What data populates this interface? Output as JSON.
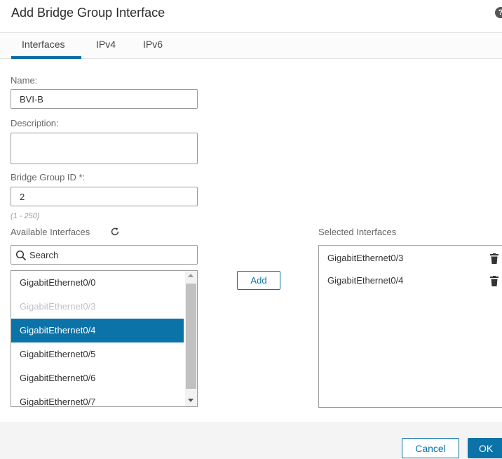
{
  "dialog": {
    "title": "Add Bridge Group Interface",
    "help_icon": "?"
  },
  "tabs": [
    {
      "label": "Interfaces",
      "active": true
    },
    {
      "label": "IPv4",
      "active": false
    },
    {
      "label": "IPv6",
      "active": false
    }
  ],
  "form": {
    "name_label": "Name:",
    "name_value": "BVI-B",
    "description_label": "Description:",
    "description_value": "",
    "bridge_group_id_label": "Bridge Group ID *:",
    "bridge_group_id_value": "2",
    "bridge_group_id_hint": "(1 - 250)"
  },
  "available": {
    "label": "Available Interfaces",
    "refresh_icon": "refresh-icon",
    "search_placeholder": "Search",
    "items": [
      {
        "label": "GigabitEthernet0/0",
        "state": "normal"
      },
      {
        "label": "GigabitEthernet0/3",
        "state": "disabled"
      },
      {
        "label": "GigabitEthernet0/4",
        "state": "selected"
      },
      {
        "label": "GigabitEthernet0/5",
        "state": "normal"
      },
      {
        "label": "GigabitEthernet0/6",
        "state": "normal"
      },
      {
        "label": "GigabitEthernet0/7",
        "state": "normal"
      }
    ]
  },
  "add_button": "Add",
  "selected": {
    "label": "Selected Interfaces",
    "items": [
      {
        "label": "GigabitEthernet0/3"
      },
      {
        "label": "GigabitEthernet0/4"
      }
    ]
  },
  "footer": {
    "cancel_label": "Cancel",
    "ok_label": "OK"
  },
  "colors": {
    "accent": "#0b73a8",
    "selected_row_bg": "#0b73a8",
    "disabled_text": "#c2c2c2"
  }
}
